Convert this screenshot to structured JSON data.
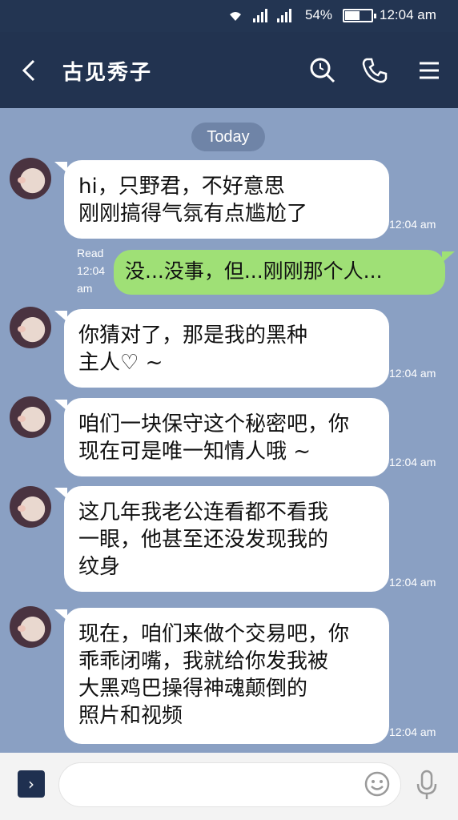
{
  "status_bar": {
    "wifi_icon": "wifi-icon",
    "battery_percent": "54%",
    "battery_level": 0.54,
    "time": "12:04 am"
  },
  "header": {
    "title": "古见秀子",
    "icons": [
      "back-icon",
      "search-icon",
      "phone-icon",
      "menu-icon"
    ]
  },
  "chat": {
    "date_divider": "Today",
    "messages": [
      {
        "direction": "in",
        "text": "hi，只野君，不好意思\n刚刚搞得气氛有点尴尬了",
        "time": "12:04 am"
      },
      {
        "direction": "out",
        "text": "没...没事，但...刚刚那个人...",
        "read": "Read",
        "time": "12:04\nam"
      },
      {
        "direction": "in",
        "text": "你猜对了，那是我的黑种\n主人♡ ~",
        "time": "12:04 am"
      },
      {
        "direction": "in",
        "text": "咱们一块保守这个秘密吧，你\n现在可是唯一知情人哦 ~",
        "time": "12:04 am"
      },
      {
        "direction": "in",
        "text": "这几年我老公连看都不看我\n一眼，他甚至还没发现我的\n纹身",
        "time": "12:04 am"
      },
      {
        "direction": "in",
        "text": "现在，咱们来做个交易吧，你\n乖乖闭嘴，我就给你发我被\n大黑鸡巴操得神魂颠倒的\n照片和视频",
        "time": "12:04 am"
      }
    ]
  },
  "input_bar": {
    "placeholder": "",
    "icons": [
      "chevron-right-icon",
      "emoji-icon",
      "microphone-icon"
    ]
  },
  "colors": {
    "header_bg": "#223350",
    "chat_bg": "#8aa0c3",
    "incoming_bubble": "#ffffff",
    "outgoing_bubble": "#9fe076"
  }
}
